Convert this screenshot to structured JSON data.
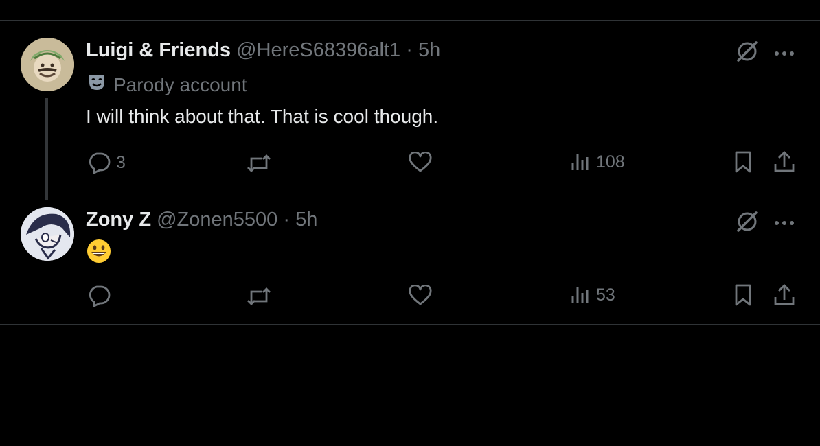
{
  "colors": {
    "background": "#000000",
    "text": "#e7e9ea",
    "muted": "#71767b",
    "divider": "#2f3336"
  },
  "tweets": [
    {
      "display_name": "Luigi & Friends",
      "handle": "@HereS68396alt1",
      "separator": "·",
      "time": "5h",
      "badge_icon": "theater-mask-icon",
      "badge_label": "Parody account",
      "text": "I will think about that. That is cool though.",
      "stats": {
        "replies": "3",
        "reposts": "",
        "likes": "",
        "views": "108"
      }
    },
    {
      "display_name": "Zony Z",
      "handle": "@Zonen5500",
      "separator": "·",
      "time": "5h",
      "text_emoji": "grinning-face-emoji",
      "stats": {
        "replies": "",
        "reposts": "",
        "likes": "",
        "views": "53"
      }
    }
  ],
  "icons": [
    "reply-icon",
    "repost-icon",
    "like-icon",
    "views-icon",
    "bookmark-icon",
    "share-icon",
    "grok-icon",
    "more-icon"
  ]
}
